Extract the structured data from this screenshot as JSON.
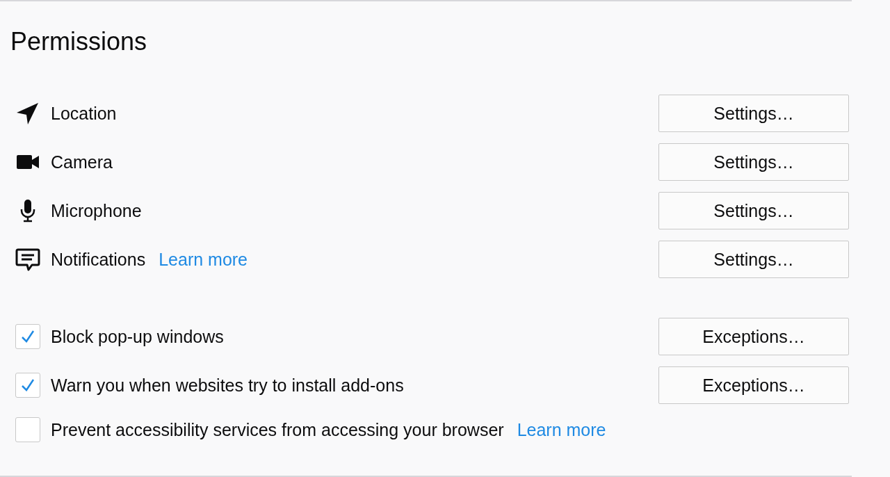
{
  "title": "Permissions",
  "permissions": [
    {
      "kind": "location",
      "label": "Location",
      "button": "Settings…"
    },
    {
      "kind": "camera",
      "label": "Camera",
      "button": "Settings…"
    },
    {
      "kind": "microphone",
      "label": "Microphone",
      "button": "Settings…"
    },
    {
      "kind": "notifications",
      "label": "Notifications",
      "link": "Learn more",
      "button": "Settings…"
    }
  ],
  "options": [
    {
      "label": "Block pop-up windows",
      "checked": true,
      "button": "Exceptions…"
    },
    {
      "label": "Warn you when websites try to install add-ons",
      "checked": true,
      "button": "Exceptions…"
    },
    {
      "label": "Prevent accessibility services from accessing your browser",
      "checked": false,
      "link": "Learn more"
    }
  ]
}
